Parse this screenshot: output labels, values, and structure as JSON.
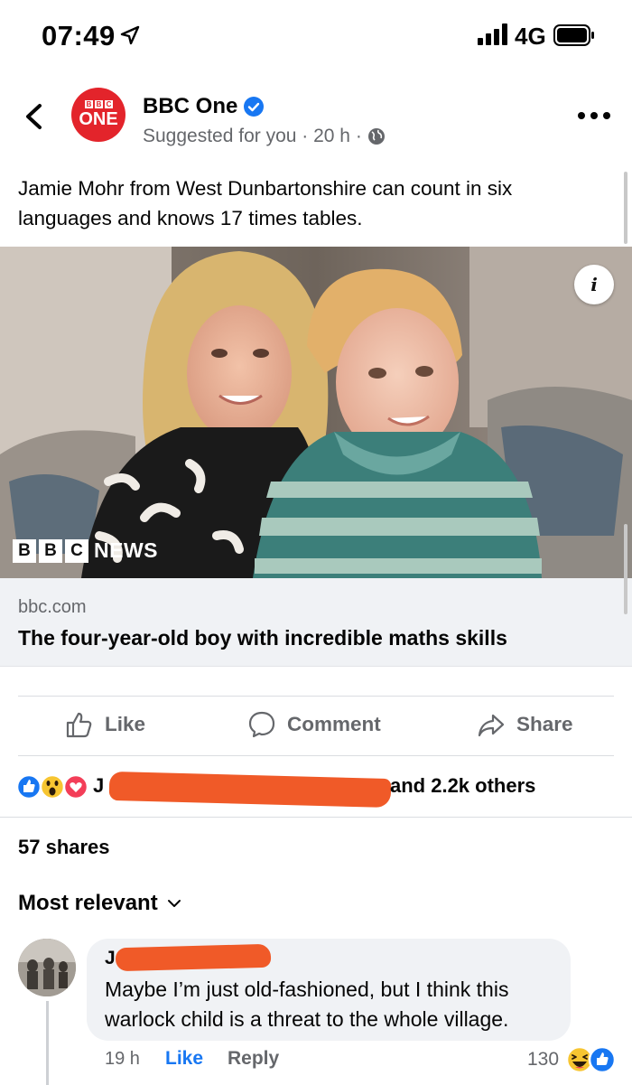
{
  "status_bar": {
    "time": "07:49",
    "network": "4G",
    "icons": [
      "location-arrow-icon",
      "signal-bars-icon",
      "battery-icon"
    ]
  },
  "post": {
    "page_name": "BBC One",
    "avatar_text": "ONE",
    "avatar_blocks": [
      "B",
      "B",
      "C"
    ],
    "meta": "Suggested for you · 20 h ·",
    "caption": "Jamie Mohr from West Dunbartonshire can count in six languages and knows 17 times tables.",
    "image_badge": "i",
    "image_logo_blocks": [
      "B",
      "B",
      "C"
    ],
    "image_logo_text": "NEWS",
    "link_domain": "bbc.com",
    "link_title": "The four-year-old boy with incredible maths skills",
    "colors": {
      "brand_red": "#e3242b",
      "facebook_blue": "#1877f2",
      "muted": "#65676b",
      "redaction": "#f05a28"
    }
  },
  "actions": {
    "like": "Like",
    "comment": "Comment",
    "share": "Share"
  },
  "engagement": {
    "reaction_icons": [
      "like-reaction-icon",
      "wow-reaction-icon",
      "love-reaction-icon"
    ],
    "reactors_visible_prefix": "J",
    "reactors_suffix": "and 2.2k others",
    "shares": "57 shares",
    "sort_label": "Most relevant"
  },
  "comment": {
    "author_visible": "J",
    "text": "Maybe I’m just old-fashioned, but I think this warlock child is a threat to the whole village.",
    "time": "19 h",
    "like": "Like",
    "reply": "Reply",
    "reaction_count": "130",
    "reaction_icons": [
      "haha-reaction-icon",
      "like-reaction-icon"
    ]
  }
}
